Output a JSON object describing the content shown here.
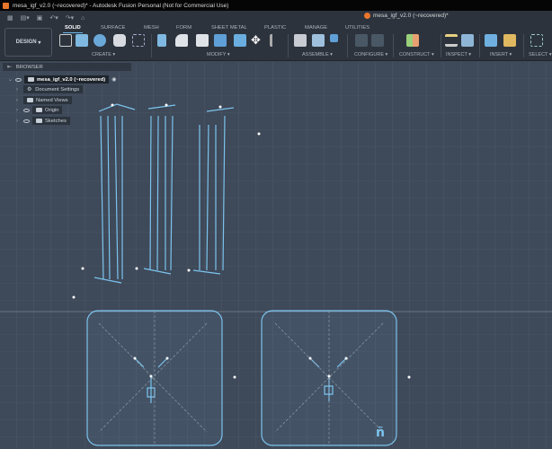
{
  "window_title": "mesa_igf_v2.0 (~recovered)* - Autodesk Fusion Personal (Not for Commercial Use)",
  "doc_tab": "mesa_igf_v2.0 (~recovered)*",
  "workspace": "DESIGN",
  "tabs": [
    "SOLID",
    "SURFACE",
    "MESH",
    "FORM",
    "SHEET METAL",
    "PLASTIC",
    "MANAGE",
    "UTILITIES"
  ],
  "active_tab": "SOLID",
  "groups": [
    "CREATE",
    "MODIFY",
    "ASSEMBLE",
    "CONFIGURE",
    "CONSTRUCT",
    "INSPECT",
    "INSERT",
    "SELECT"
  ],
  "browser": {
    "title": "BROWSER",
    "root": "mesa_igf_v2.0 (~recovered)",
    "items": [
      "Document Settings",
      "Named Views",
      "Origin",
      "Sketches"
    ]
  },
  "canvas_glyph": "ñ",
  "colors": {
    "accent": "#6cb6e8",
    "canvas": "#3e4959",
    "sketch": "#7cc4ee"
  }
}
